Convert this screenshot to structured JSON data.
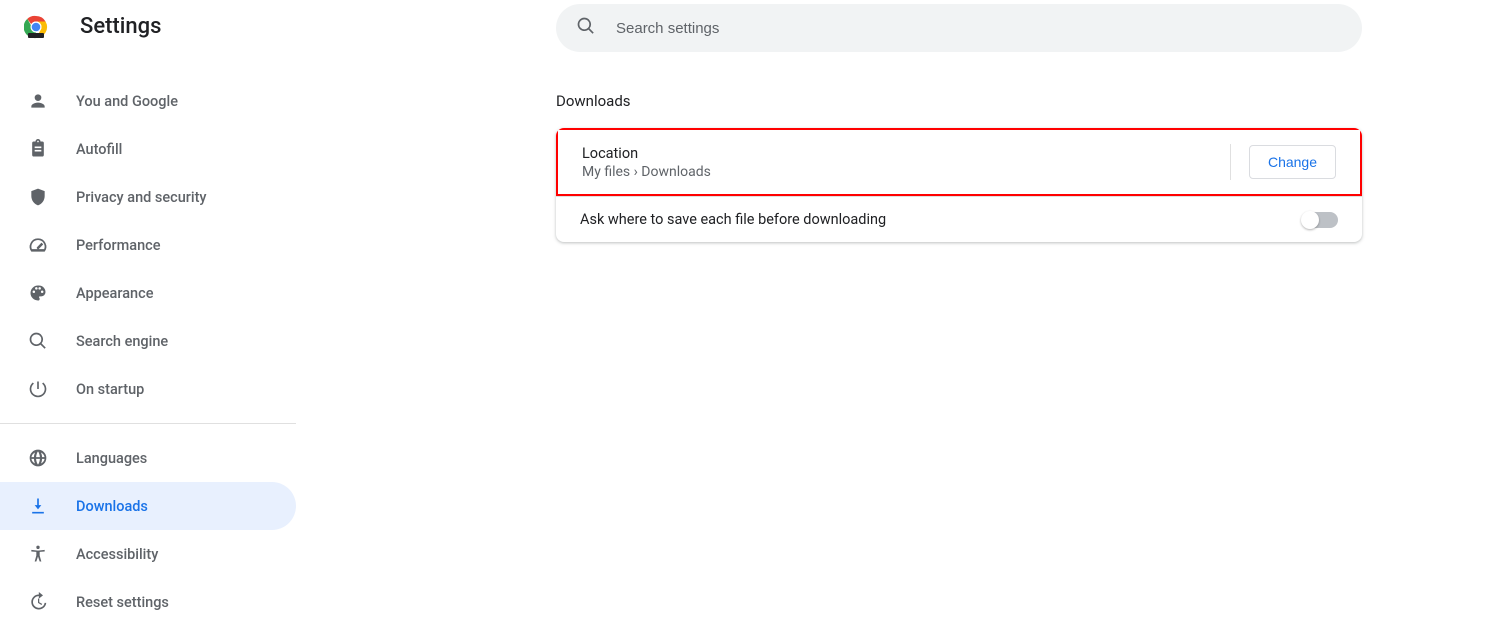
{
  "header": {
    "title": "Settings"
  },
  "search": {
    "placeholder": "Search settings"
  },
  "sidebar": {
    "items": [
      {
        "id": "you-google",
        "label": "You and Google",
        "icon": "person"
      },
      {
        "id": "autofill",
        "label": "Autofill",
        "icon": "clipboard"
      },
      {
        "id": "privacy",
        "label": "Privacy and security",
        "icon": "shield"
      },
      {
        "id": "performance",
        "label": "Performance",
        "icon": "speed"
      },
      {
        "id": "appearance",
        "label": "Appearance",
        "icon": "palette"
      },
      {
        "id": "search-eng",
        "label": "Search engine",
        "icon": "search"
      },
      {
        "id": "startup",
        "label": "On startup",
        "icon": "power"
      },
      {
        "id": "languages",
        "label": "Languages",
        "icon": "globe"
      },
      {
        "id": "downloads",
        "label": "Downloads",
        "icon": "download",
        "active": true
      },
      {
        "id": "accessibility",
        "label": "Accessibility",
        "icon": "accessibility"
      },
      {
        "id": "reset",
        "label": "Reset settings",
        "icon": "history"
      }
    ]
  },
  "main": {
    "section_title": "Downloads",
    "location": {
      "label": "Location",
      "value": "My files › Downloads",
      "change_button": "Change"
    },
    "ask_where": {
      "label": "Ask where to save each file before downloading",
      "enabled": false
    }
  }
}
